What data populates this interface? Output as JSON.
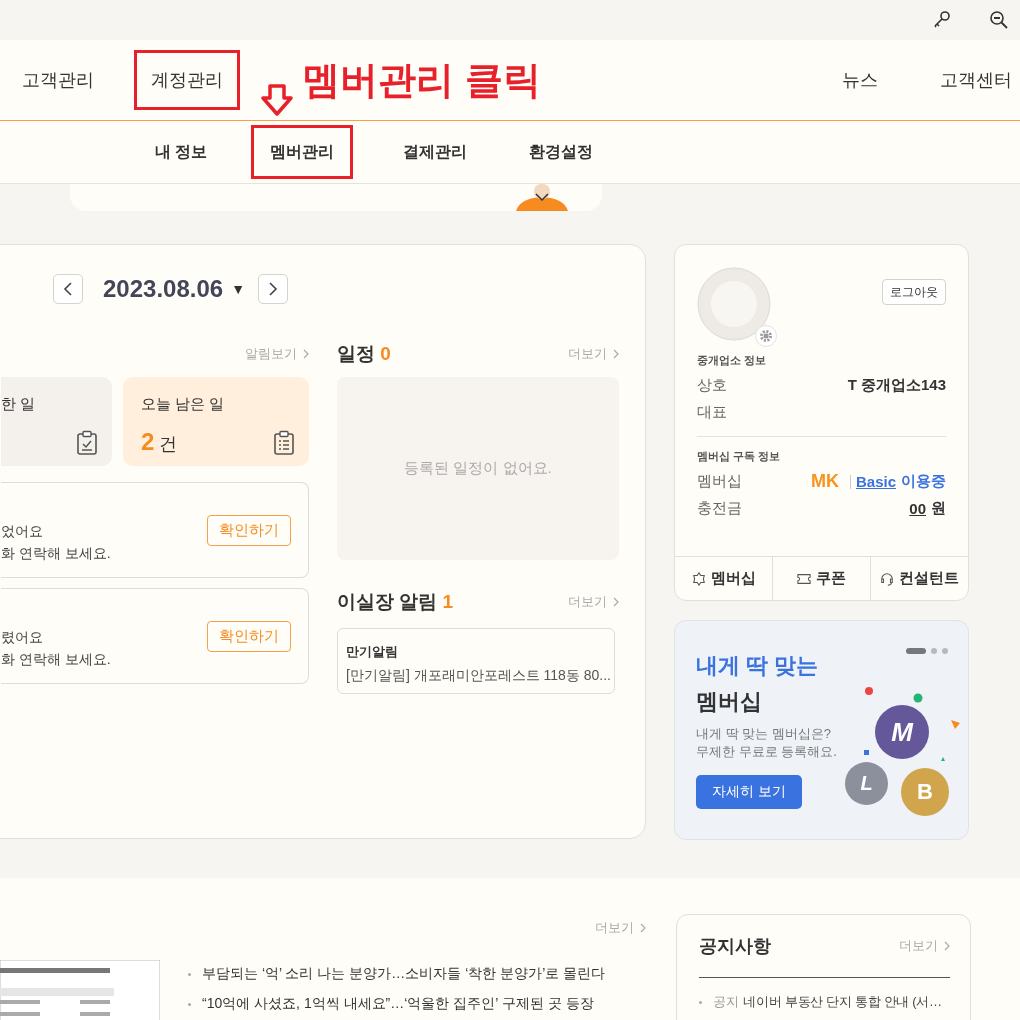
{
  "nav": {
    "items": [
      {
        "label": "고객관리",
        "annotated": false
      },
      {
        "label": "계정관리",
        "annotated": true
      }
    ],
    "right_items": [
      "뉴스",
      "고객센터"
    ]
  },
  "annotation": {
    "text": "멤버관리 클릭"
  },
  "subnav": [
    {
      "label": "내 정보",
      "annotated": false
    },
    {
      "label": "멤버관리",
      "annotated": true
    },
    {
      "label": "결제관리",
      "annotated": false
    },
    {
      "label": "환경설정",
      "annotated": false
    }
  ],
  "date": {
    "value": "2023.08.06",
    "caret": "▼"
  },
  "tasks": {
    "link": "알림보기",
    "stats": [
      {
        "label": "한 일",
        "highlighted": false
      },
      {
        "label": "오늘 남은 일",
        "count": "2",
        "unit": "건",
        "highlighted": true
      }
    ],
    "alerts": [
      {
        "lines": [
          "었어요",
          "화 연락해 보세요."
        ],
        "button": "확인하기"
      },
      {
        "lines": [
          "렸어요",
          "화 연락해 보세요."
        ],
        "button": "확인하기"
      }
    ]
  },
  "schedule": {
    "title": "일정",
    "count": "0",
    "more": "더보기",
    "empty": "등록된 일정이 없어요."
  },
  "notifications": {
    "title": "이실장 알림",
    "count": "1",
    "more": "더보기",
    "items": [
      {
        "title": "만기알림",
        "text": "[만기알림] 개포래미안포레스트 118동 80..."
      }
    ]
  },
  "profile": {
    "logout": "로그아웃",
    "office_heading": "중개업소 정보",
    "office_rows": [
      {
        "label": "상호",
        "value": "T 중개업소143"
      },
      {
        "label": "대표"
      }
    ],
    "membership_heading": "멤버십 구독 정보",
    "membership_label": "멤버십",
    "membership_logo": "MK",
    "plan": "Basic",
    "plan_status": "이용중",
    "balance_label": "충전금",
    "balance": "00",
    "balance_unit": "원",
    "tabs": [
      "멤버십",
      "쿠폰",
      "컨설턴트"
    ]
  },
  "promo": {
    "title_accent": "내게 딱 맞는",
    "title": "멤버십",
    "lines": [
      "내게 딱 맞는 멤버십은?",
      "무제한 무료로 등록해요."
    ],
    "button": "자세히 보기",
    "pages": [
      {
        "selected": true
      },
      {
        "selected": false
      },
      {
        "selected": false
      }
    ],
    "coins": [
      "M",
      "L",
      "B"
    ]
  },
  "news": {
    "more": "더보기",
    "headlines": [
      "부담되는 ‘억’ 소리 나는 분양가…소비자들 ‘착한 분양가’로 몰린다",
      "“10억에 사셨죠, 1억씩 내세요”…‘억울한 집주인’ 구제된 곳 등장"
    ]
  },
  "notice": {
    "title": "공지사항",
    "more": "더보기",
    "items": [
      {
        "tag": "공지",
        "text": "네이버 부동산 단지 통합 안내 (서…"
      }
    ]
  }
}
